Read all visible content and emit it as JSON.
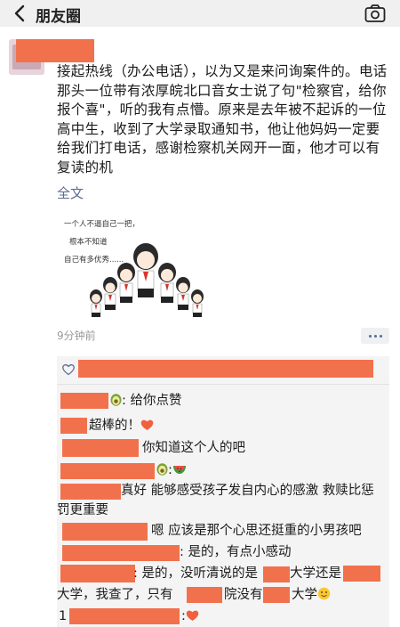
{
  "nav": {
    "title": "朋友圈"
  },
  "post": {
    "text": "接起热线（办公电话），以为又是来问询案件的。电话那头一位带有浓厚皖北口音女士说了句\"检察官，给你报个喜\"，听的我有点懵。原来是去年被不起诉的一位高中生，收到了大学录取通知书，他让他妈妈一定要给我们打电话，感谢检察机关网开一面，他才可以有复读的机",
    "full_text_link": "全文",
    "time": "9分钟前",
    "image_caption_lines": [
      "一个人不逼自己一把，",
      "根本不知道",
      "自己有多优秀......"
    ]
  },
  "comments": [
    {
      "text": ": 给你点赞",
      "emoji": "avocado"
    },
    {
      "text": "超棒的！",
      "emoji": "heart"
    },
    {
      "text": "你知道这个人的吧"
    },
    {
      "text": ":",
      "emoji": "watermelon"
    },
    {
      "text": "真好 能够感受孩子发自内心的感激 救赎比惩罚更重要"
    },
    {
      "text": "嗯 应该是那个心思还挺重的小男孩吧"
    },
    {
      "text": ": 是的，有点小感动"
    },
    {
      "text_a": ": 是的，没听清说的是",
      "text_b": "大学还是",
      "text_c": "大学，我查了，只有",
      "text_d": "院没有",
      "text_e": "大学",
      "emoji": "smiley"
    },
    {
      "prefix": "1",
      "text": ":",
      "emoji": "heart"
    }
  ],
  "colors": {
    "redaction": "#f2714d",
    "link": "#586b8f",
    "nav_bg": "#f0f0f0",
    "comment_bg": "#f4f4f4"
  }
}
